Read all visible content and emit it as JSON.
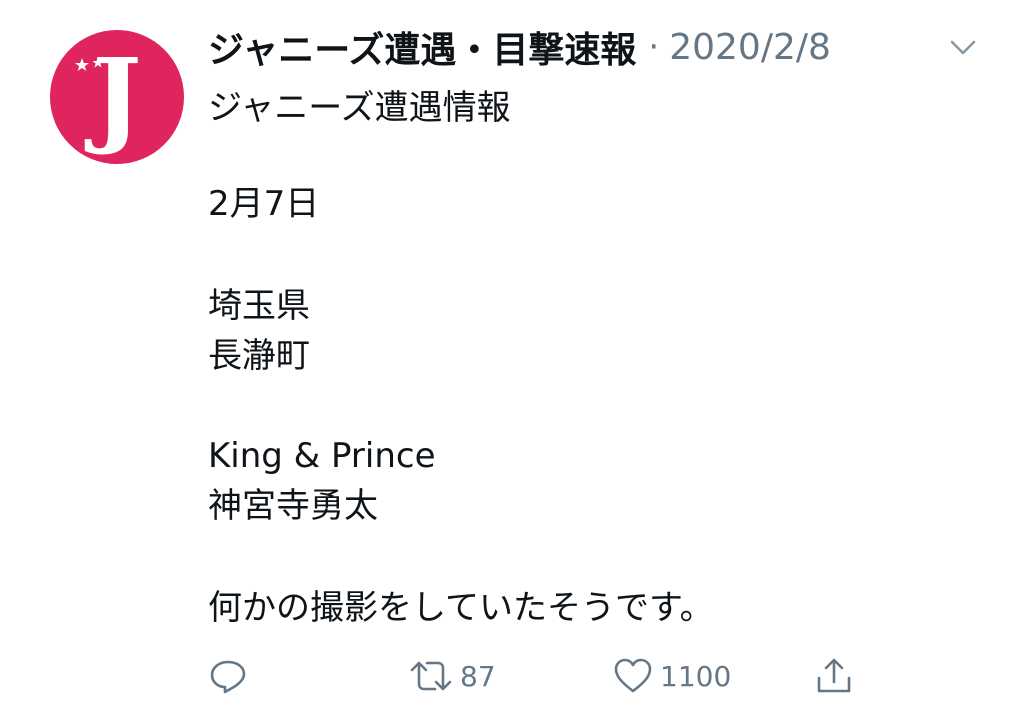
{
  "tweet": {
    "avatar_letter": "J",
    "user_name": "ジャニーズ遭遇・目撃速報",
    "separator": "·",
    "date": "2020/2/8",
    "handle_line": "ジャニーズ遭遇情報",
    "lines": {
      "date_line": "2月7日",
      "prefecture": "埼玉県",
      "town": "長瀞町",
      "group": "King & Prince",
      "member": "神宮寺勇太",
      "message": "何かの撮影をしていたそうです。"
    },
    "actions": {
      "reply_icon": "reply-icon",
      "retweet_icon": "retweet-icon",
      "retweet_count": "87",
      "like_icon": "heart-icon",
      "like_count": "1100",
      "share_icon": "share-icon"
    },
    "colors": {
      "avatar_bg": "#e0245e",
      "secondary_text": "#657786",
      "primary_text": "#0f1419"
    }
  }
}
